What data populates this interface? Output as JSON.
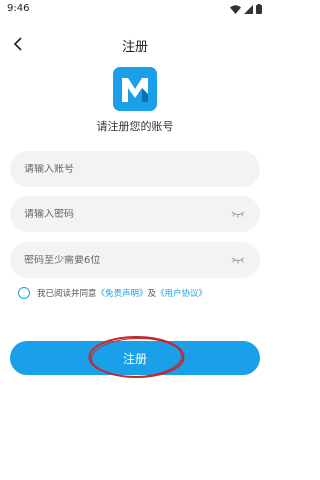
{
  "status_bar": {
    "time": "9:46"
  },
  "header": {
    "title": "注册"
  },
  "logo": {
    "letter": "M"
  },
  "subtitle": "请注册您的账号",
  "form": {
    "account_placeholder": "请输入账号",
    "password_placeholder": "请输入密码",
    "confirm_placeholder": "密码至少需要6位"
  },
  "agreement": {
    "prefix": "我已阅读并同意",
    "disclaimer_link": "《免责声明》",
    "and": "及",
    "user_agreement_link": "《用户协议》"
  },
  "submit_label": "注册",
  "colors": {
    "accent": "#1aa0e8",
    "field_bg": "#f3f3f3",
    "annotation": "#c62828"
  }
}
